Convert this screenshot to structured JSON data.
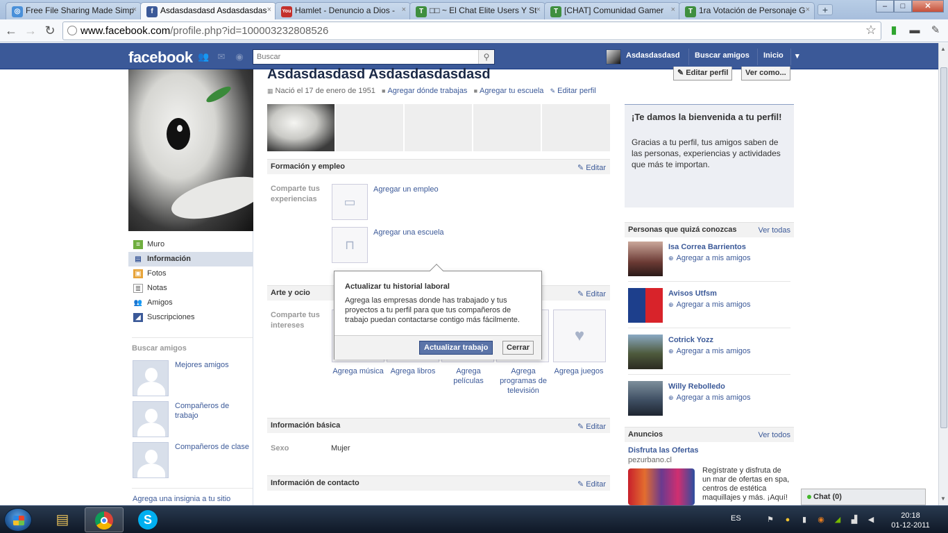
{
  "browser": {
    "tabs": [
      {
        "title": "Free File Sharing Made Simp",
        "icon": "mediafire-icon",
        "active": false
      },
      {
        "title": "Asdasdasdasd Asdasdasdas",
        "icon": "facebook-icon",
        "active": true
      },
      {
        "title": "Hamlet - Denuncio a Dios -",
        "icon": "youtube-icon",
        "active": false
      },
      {
        "title": "□□ ~ El Chat Elite Users Y St",
        "icon": "forum-icon",
        "active": false
      },
      {
        "title": "[CHAT] Comunidad Gamer",
        "icon": "forum-icon",
        "active": false
      },
      {
        "title": "1ra Votación de Personaje G",
        "icon": "forum-icon",
        "active": false
      }
    ],
    "tab_close": "×",
    "new_tab": "+",
    "window_controls": {
      "minimize": "–",
      "maximize": "□",
      "close": "✕"
    },
    "url_host": "www.facebook.com",
    "url_path": "/profile.php?id=100003232808526",
    "nav": {
      "back": "←",
      "forward": "→",
      "reload": "↻"
    }
  },
  "facebook": {
    "logo": "facebook",
    "search_placeholder": "Buscar",
    "top_user": "Asdasdasdasd",
    "top_find_friends": "Buscar amigos",
    "top_home": "Inicio",
    "top_menu_arrow": "▾"
  },
  "profile": {
    "name": "Asdasdasdasd Asdasdasdasdasd",
    "born": "Nació el 17 de enero de 1951",
    "add_work": "Agregar dónde trabajas",
    "add_school": "Agregar tu escuela",
    "edit_profile_link": "Editar perfil",
    "edit_profile_button": "Editar perfil",
    "view_as_button": "Ver como..."
  },
  "left_nav": {
    "items": [
      {
        "label": "Muro",
        "icon": "wall-icon",
        "selected": false
      },
      {
        "label": "Información",
        "icon": "info-icon",
        "selected": true
      },
      {
        "label": "Fotos",
        "icon": "photos-icon",
        "selected": false
      },
      {
        "label": "Notas",
        "icon": "notes-icon",
        "selected": false
      },
      {
        "label": "Amigos",
        "icon": "friends-icon",
        "selected": false
      },
      {
        "label": "Suscripciones",
        "icon": "subscriptions-icon",
        "selected": false
      }
    ],
    "find_friends_heading": "Buscar amigos",
    "suggestions": [
      "Mejores amigos",
      "Compañeros de trabajo",
      "Compañeros de clase"
    ],
    "badge_link": "Agrega una insignia a tu sitio"
  },
  "sections": {
    "education": {
      "title": "Formación y empleo",
      "edit": "Editar",
      "label": "Comparte tus experiencias",
      "add_job": "Agregar un empleo",
      "add_school": "Agregar una escuela"
    },
    "arts": {
      "title": "Arte y ocio",
      "edit": "Editar",
      "label": "Comparte tus intereses",
      "items": [
        "Agrega música",
        "Agrega libros",
        "Agrega películas",
        "Agrega programas de televisión",
        "Agrega juegos"
      ]
    },
    "basic": {
      "title": "Información básica",
      "edit": "Editar",
      "sex_label": "Sexo",
      "sex_value": "Mujer"
    },
    "contact": {
      "title": "Información de contacto",
      "edit": "Editar"
    }
  },
  "popup": {
    "title": "Actualizar tu historial laboral",
    "text": "Agrega las empresas donde has trabajado y tus proyectos a tu perfil para que tus compañeros de trabajo puedan contactarse contigo más fácilmente.",
    "primary": "Actualizar trabajo",
    "secondary": "Cerrar"
  },
  "welcome": {
    "title": "¡Te damos la bienvenida a tu perfil!",
    "text": "Gracias a tu perfil, tus amigos saben de las personas, experiencias y actividades que más te importan."
  },
  "pymk": {
    "title": "Personas que quizá conozcas",
    "see_all": "Ver todas",
    "add_label": "Agregar a mis amigos",
    "people": [
      "Isa Correa Barrientos",
      "Avisos Utfsm",
      "Cotrick Yozz",
      "Willy Rebolledo"
    ]
  },
  "ads": {
    "title": "Anuncios",
    "see_all": "Ver todos",
    "ad_title": "Disfruta las Ofertas",
    "ad_domain": "pezurbano.cl",
    "ad_text": "Regístrate y disfruta de un mar de ofertas en spa, centros de estética maquillajes y más. ¡Aquí!"
  },
  "chat": {
    "label": "Chat (0)"
  },
  "taskbar": {
    "lang": "ES",
    "time": "20:18",
    "date": "01-12-2011"
  },
  "colors": {
    "fb_blue": "#3b5998",
    "link": "#3b5998",
    "primary_button": "#5b74a8"
  }
}
